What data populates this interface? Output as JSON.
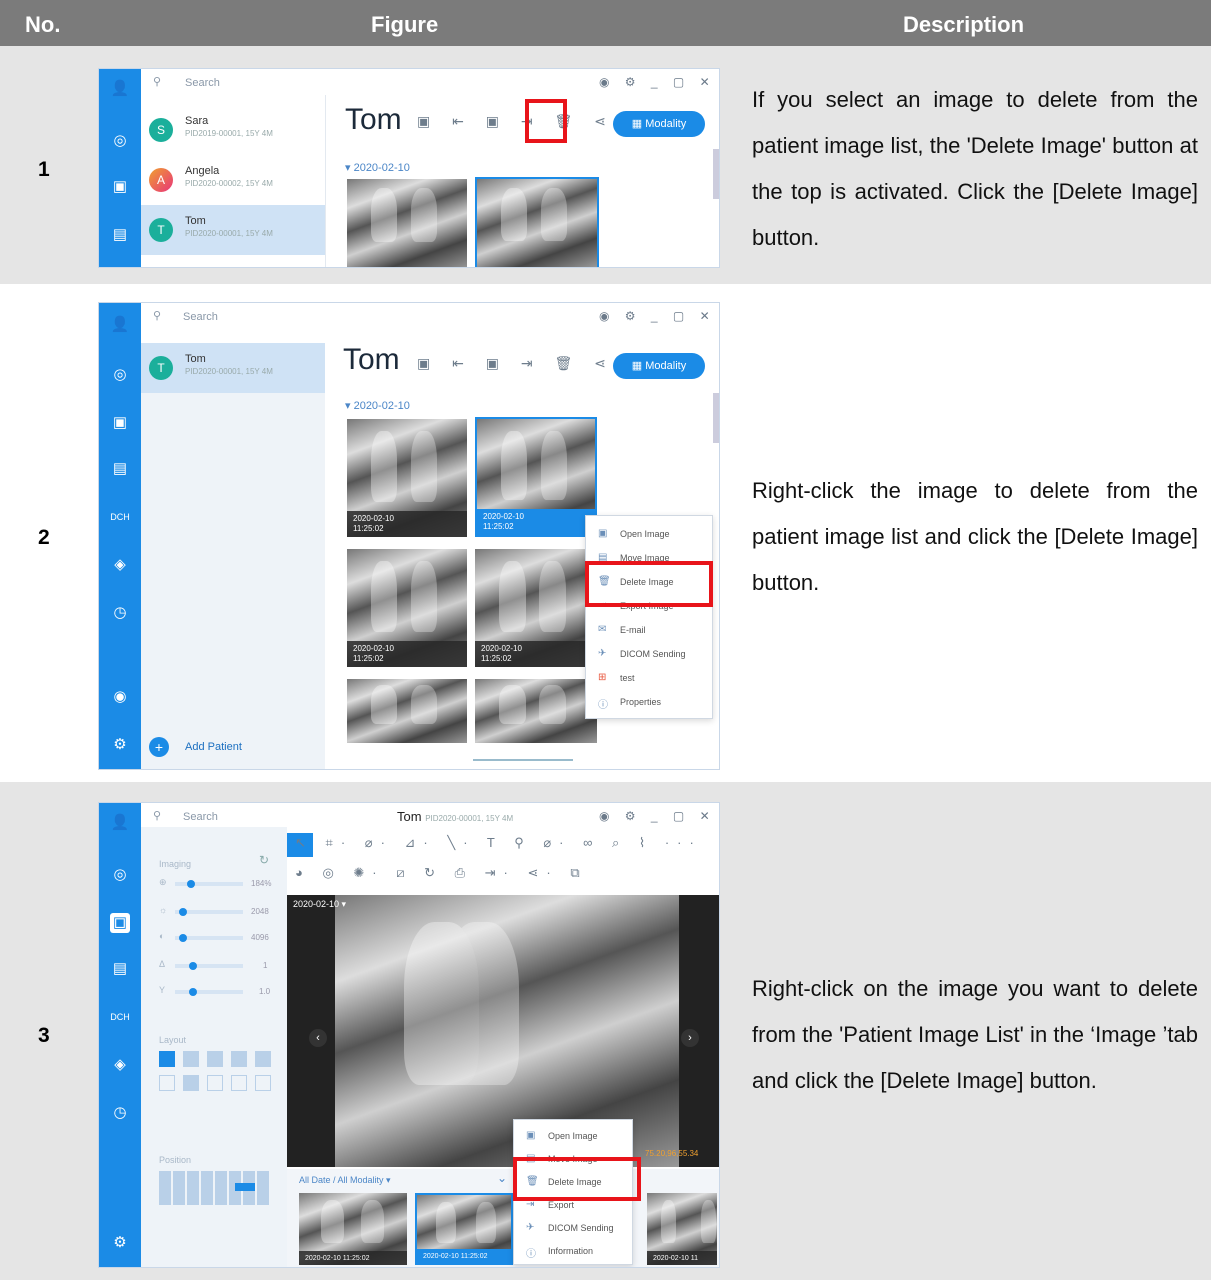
{
  "header": {
    "no": "No.",
    "figure": "Figure",
    "description": "Description"
  },
  "rows": [
    {
      "no": "1",
      "description": "If you select an image to delete from the patient image list, the 'Delete Image' button at the top is activated. Click the [Delete Image] button."
    },
    {
      "no": "2",
      "description": "Right-click the image to delete from the patient image list and click the [Delete Image] button."
    },
    {
      "no": "3",
      "description": "Right-click on the image you want to delete from the 'Patient Image List' in the ‘Image ’tab and click the [Delete Image] button."
    }
  ],
  "app": {
    "search_placeholder": "Search",
    "window_controls": "◉ ⚙ _ ▢ ✕",
    "modality_label": "Modality",
    "toolbar_icons": "▣ ⇤ ▣ ⇥ 🗑 ⋖·",
    "date_group": "▾ 2020-02-10",
    "thumb_date": "2020-02-10",
    "thumb_time": "11:25:02",
    "add_patient": "Add Patient"
  },
  "shot1": {
    "patients": [
      {
        "initial": "S",
        "name": "Sara",
        "pid": "PID2019-00001, 15Y 4M",
        "color": "#1baf9b"
      },
      {
        "initial": "A",
        "name": "Angela",
        "pid": "PID2020-00002, 15Y 4M",
        "color": "#e8553b"
      },
      {
        "initial": "T",
        "name": "Tom",
        "pid": "PID2020-00001, 15Y 4M",
        "color": "#1baf9b"
      }
    ],
    "title": "Tom"
  },
  "shot2": {
    "patient": {
      "initial": "T",
      "name": "Tom",
      "pid": "PID2020-00001, 15Y 4M"
    },
    "title": "Tom",
    "menu": [
      {
        "icon": "▣",
        "label": "Open Image"
      },
      {
        "icon": "▤",
        "label": "Move Image"
      },
      {
        "icon": "🗑",
        "label": "Delete Image"
      },
      {
        "icon": "⇥",
        "label": "Export Image"
      },
      {
        "icon": "✉",
        "label": "E-mail"
      },
      {
        "icon": "✈",
        "label": "DICOM Sending"
      },
      {
        "icon": "⊞",
        "label": "test"
      },
      {
        "icon": "ⓘ",
        "label": "Properties"
      }
    ]
  },
  "shot3": {
    "title": "Tom",
    "title_pid": "PID2020-00001, 15Y 4M",
    "imaging_label": "Imaging",
    "sliders": [
      {
        "icon": "⊕",
        "value": "184%",
        "fill": 0.2
      },
      {
        "icon": "☼",
        "value": "2048",
        "fill": 0.05
      },
      {
        "icon": "◐",
        "value": "4096",
        "fill": 0.05
      },
      {
        "icon": "Δ",
        "value": "1",
        "fill": 0.2
      },
      {
        "icon": "Y",
        "value": "1.0",
        "fill": 0.2
      }
    ],
    "layout_label": "Layout",
    "position_label": "Position",
    "image_date": "2020-02-10 ▾",
    "overlay_text": "75.20,96,55.34",
    "filter_label": "All Date / All Modality ▾",
    "thumbs": [
      "2020-02-10 11:25:02",
      "2020-02-10 11:25:02",
      "2020-02-10 11"
    ],
    "menu": [
      {
        "icon": "▣",
        "label": "Open Image"
      },
      {
        "icon": "▤",
        "label": "Move Image"
      },
      {
        "icon": "🗑",
        "label": "Delete Image"
      },
      {
        "icon": "⇥",
        "label": "Export"
      },
      {
        "icon": "✈",
        "label": "DICOM Sending"
      },
      {
        "icon": "ⓘ",
        "label": "Information"
      }
    ],
    "toolbar_row1": "↖ ⌗· ⌀· ⊿· ╲· T ⚲ ⌀· ∞ ⌕ ⌇ ···",
    "toolbar_row2": "◕ ◎ ✺· ⧄ ↻ ⎙ ⇥· ⋖· ⧉"
  }
}
